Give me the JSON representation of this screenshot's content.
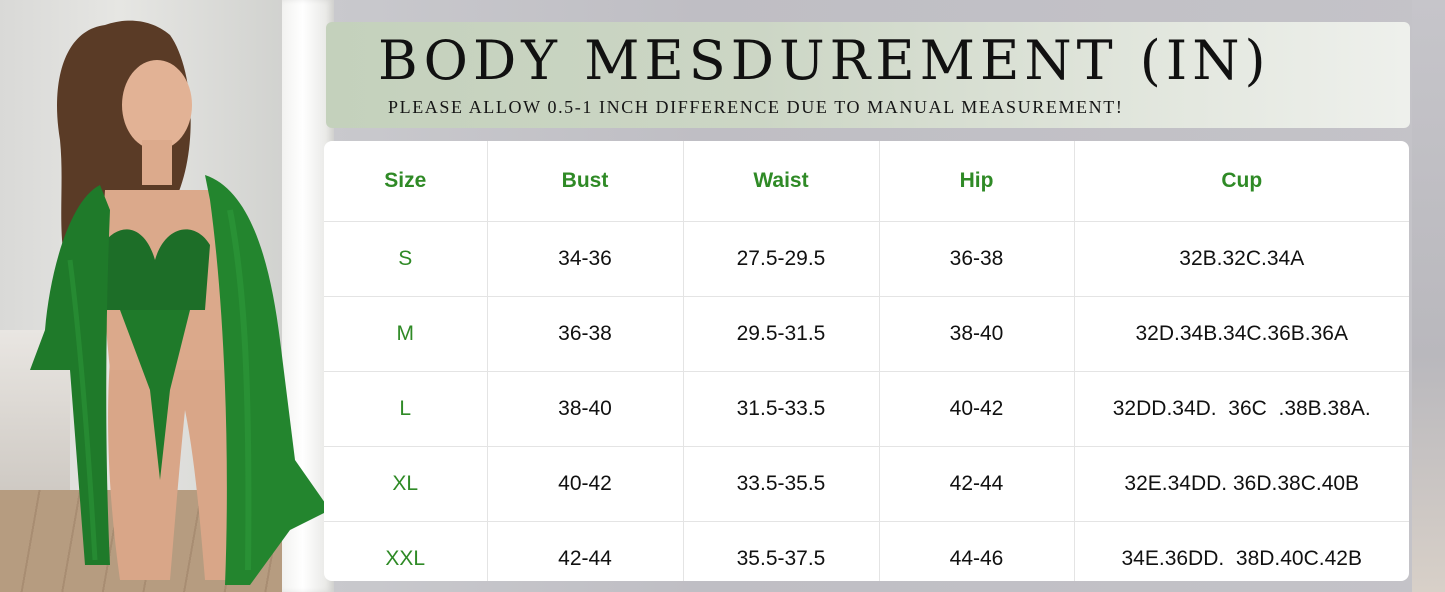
{
  "title": "BODY MESDUREMENT (IN)",
  "subtitle": "PLEASE ALLOW 0.5-1 INCH DIFFERENCE DUE TO MANUAL MEASUREMENT!",
  "colors": {
    "header_green": "#2f8a26",
    "garment_green": "#1f7a2a"
  },
  "table": {
    "headers": [
      "Size",
      "Bust",
      "Waist",
      "Hip",
      "Cup"
    ],
    "rows": [
      [
        "S",
        "34-36",
        "27.5-29.5",
        "36-38",
        "32B.32C.34A"
      ],
      [
        "M",
        "36-38",
        "29.5-31.5",
        "38-40",
        "32D.34B.34C.36B.36A"
      ],
      [
        "L",
        "38-40",
        "31.5-33.5",
        "40-42",
        "32DD.34D.  36C  .38B.38A."
      ],
      [
        "XL",
        "40-42",
        "33.5-35.5",
        "42-44",
        "32E.34DD. 36D.38C.40B"
      ],
      [
        "XXL",
        "42-44",
        "35.5-37.5",
        "44-46",
        "34E.36DD.  38D.40C.42B"
      ]
    ]
  }
}
